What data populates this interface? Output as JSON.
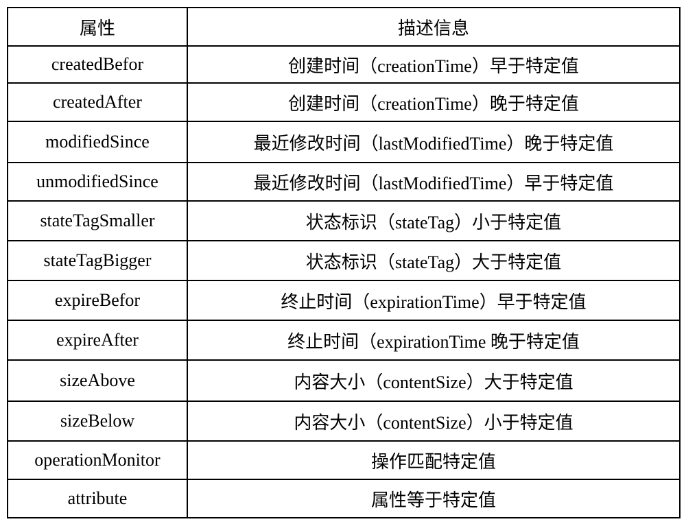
{
  "table": {
    "header": {
      "attr": "属性",
      "desc": "描述信息"
    },
    "rows": [
      {
        "attr": "createdBefor",
        "desc": "创建时间（creationTime）早于特定值"
      },
      {
        "attr": "createdAfter",
        "desc": "创建时间（creationTime）晚于特定值"
      },
      {
        "attr": "modifiedSince",
        "desc": "最近修改时间（lastModifiedTime）晚于特定值"
      },
      {
        "attr": "unmodifiedSince",
        "desc": "最近修改时间（lastModifiedTime）早于特定值"
      },
      {
        "attr": "stateTagSmaller",
        "desc": "状态标识（stateTag）小于特定值"
      },
      {
        "attr": "stateTagBigger",
        "desc": "状态标识（stateTag）大于特定值"
      },
      {
        "attr": "expireBefor",
        "desc": "终止时间（expirationTime）早于特定值"
      },
      {
        "attr": "expireAfter",
        "desc": "终止时间（expirationTime 晚于特定值"
      },
      {
        "attr": "sizeAbove",
        "desc": "内容大小（contentSize）大于特定值"
      },
      {
        "attr": "sizeBelow",
        "desc": "内容大小（contentSize）小于特定值"
      },
      {
        "attr": "operationMonitor",
        "desc": "操作匹配特定值"
      },
      {
        "attr": "attribute",
        "desc": "属性等于特定值"
      }
    ]
  }
}
